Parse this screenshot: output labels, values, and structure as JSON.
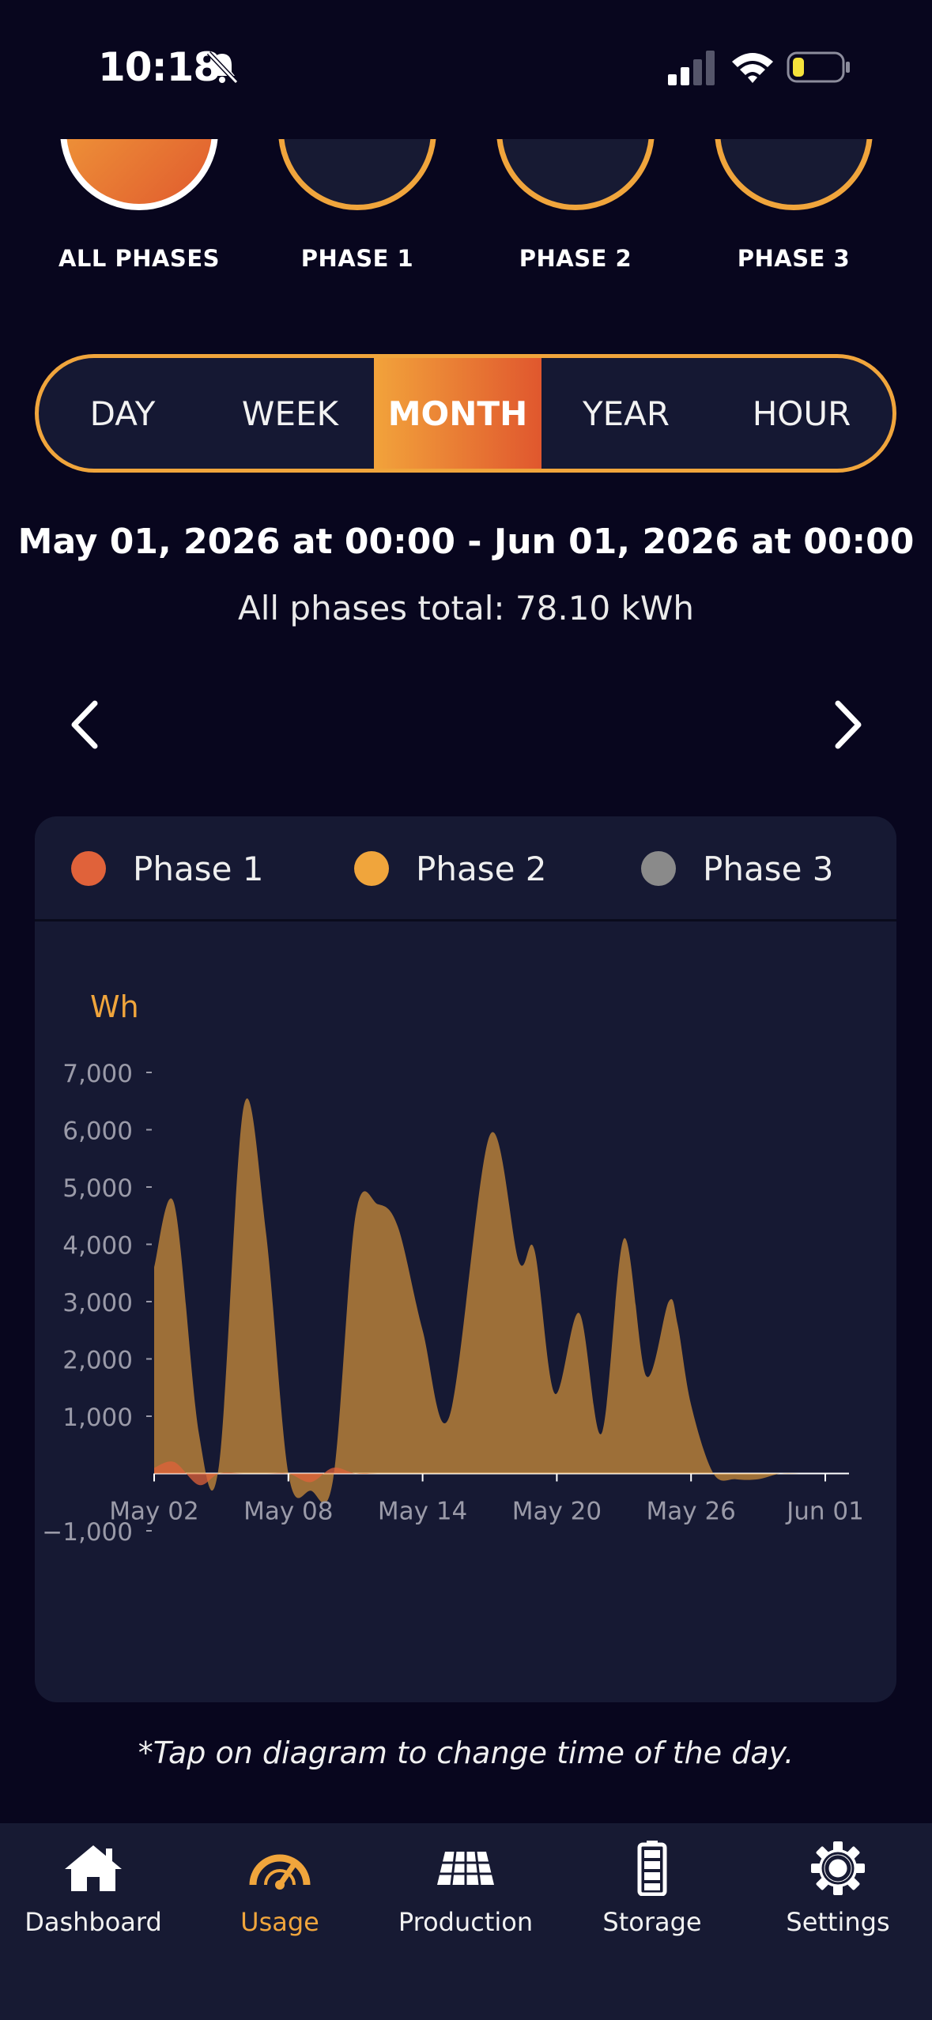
{
  "status": {
    "time": "10:18"
  },
  "phases": [
    {
      "label": "ALL PHASES",
      "active": true
    },
    {
      "label": "PHASE 1",
      "active": false
    },
    {
      "label": "PHASE 2",
      "active": false
    },
    {
      "label": "PHASE 3",
      "active": false
    }
  ],
  "period_tabs": [
    "DAY",
    "WEEK",
    "MONTH",
    "YEAR",
    "HOUR"
  ],
  "active_period": "MONTH",
  "date_range": "May 01, 2026 at 00:00 - Jun 01, 2026 at 00:00",
  "total_text": "All phases total: 78.10 kWh",
  "legend": [
    {
      "name": "Phase 1",
      "color": "#e0623a"
    },
    {
      "name": "Phase 2",
      "color": "#f0a53c"
    },
    {
      "name": "Phase 3",
      "color": "#8a8a8a"
    }
  ],
  "chart_data": {
    "type": "area",
    "ylabel": "Wh",
    "ylim": [
      -1000,
      7000
    ],
    "yticks": [
      "7,000",
      "6,000",
      "5,000",
      "4,000",
      "3,000",
      "2,000",
      "1,000",
      "−1,000"
    ],
    "ytick_values": [
      7000,
      6000,
      5000,
      4000,
      3000,
      2000,
      1000,
      -1000
    ],
    "xticks": [
      "May 02",
      "May 08",
      "May 14",
      "May 20",
      "May 26",
      "Jun 01"
    ],
    "xtick_values": [
      2,
      8,
      14,
      20,
      26,
      32
    ],
    "x": [
      2,
      2.9,
      4,
      4.9,
      6,
      7,
      8,
      9,
      10,
      11,
      12,
      12.9,
      14,
      15.2,
      17,
      18.3,
      19,
      19.9,
      21,
      22,
      23,
      24,
      25,
      25.4,
      26,
      27,
      28,
      29,
      30,
      31,
      32
    ],
    "series": [
      {
        "name": "Phase 1",
        "values": [
          100,
          200,
          -200,
          0,
          0,
          0,
          0,
          -150,
          100,
          0,
          0,
          0,
          0,
          0,
          0,
          0,
          0,
          0,
          0,
          0,
          0,
          0,
          0,
          0,
          0,
          0,
          0,
          0,
          0,
          0,
          0
        ]
      },
      {
        "name": "Phase 2",
        "values": [
          3600,
          4700,
          700,
          150,
          6400,
          4200,
          0,
          -300,
          -100,
          4500,
          4700,
          4300,
          2500,
          1000,
          5900,
          3700,
          3900,
          1400,
          2800,
          700,
          4100,
          1700,
          3000,
          2600,
          1200,
          0,
          -100,
          -100,
          0,
          0,
          0
        ]
      },
      {
        "name": "Phase 3",
        "values": [
          0,
          0,
          0,
          0,
          0,
          0,
          0,
          0,
          0,
          0,
          0,
          0,
          0,
          0,
          0,
          0,
          0,
          0,
          0,
          0,
          0,
          0,
          0,
          0,
          0,
          0,
          0,
          0,
          0,
          0,
          0
        ]
      }
    ]
  },
  "hint": "*Tap on diagram to change time of the day.",
  "bottom_nav": [
    {
      "label": "Dashboard",
      "icon": "home-icon",
      "active": false
    },
    {
      "label": "Usage",
      "icon": "gauge-icon",
      "active": true
    },
    {
      "label": "Production",
      "icon": "solar-panel-icon",
      "active": false
    },
    {
      "label": "Storage",
      "icon": "battery-icon",
      "active": false
    },
    {
      "label": "Settings",
      "icon": "gear-icon",
      "active": false
    }
  ],
  "colors": {
    "accent": "#f0a53c",
    "accent_dark": "#e0572e",
    "background": "#08061e",
    "card": "#161933"
  }
}
